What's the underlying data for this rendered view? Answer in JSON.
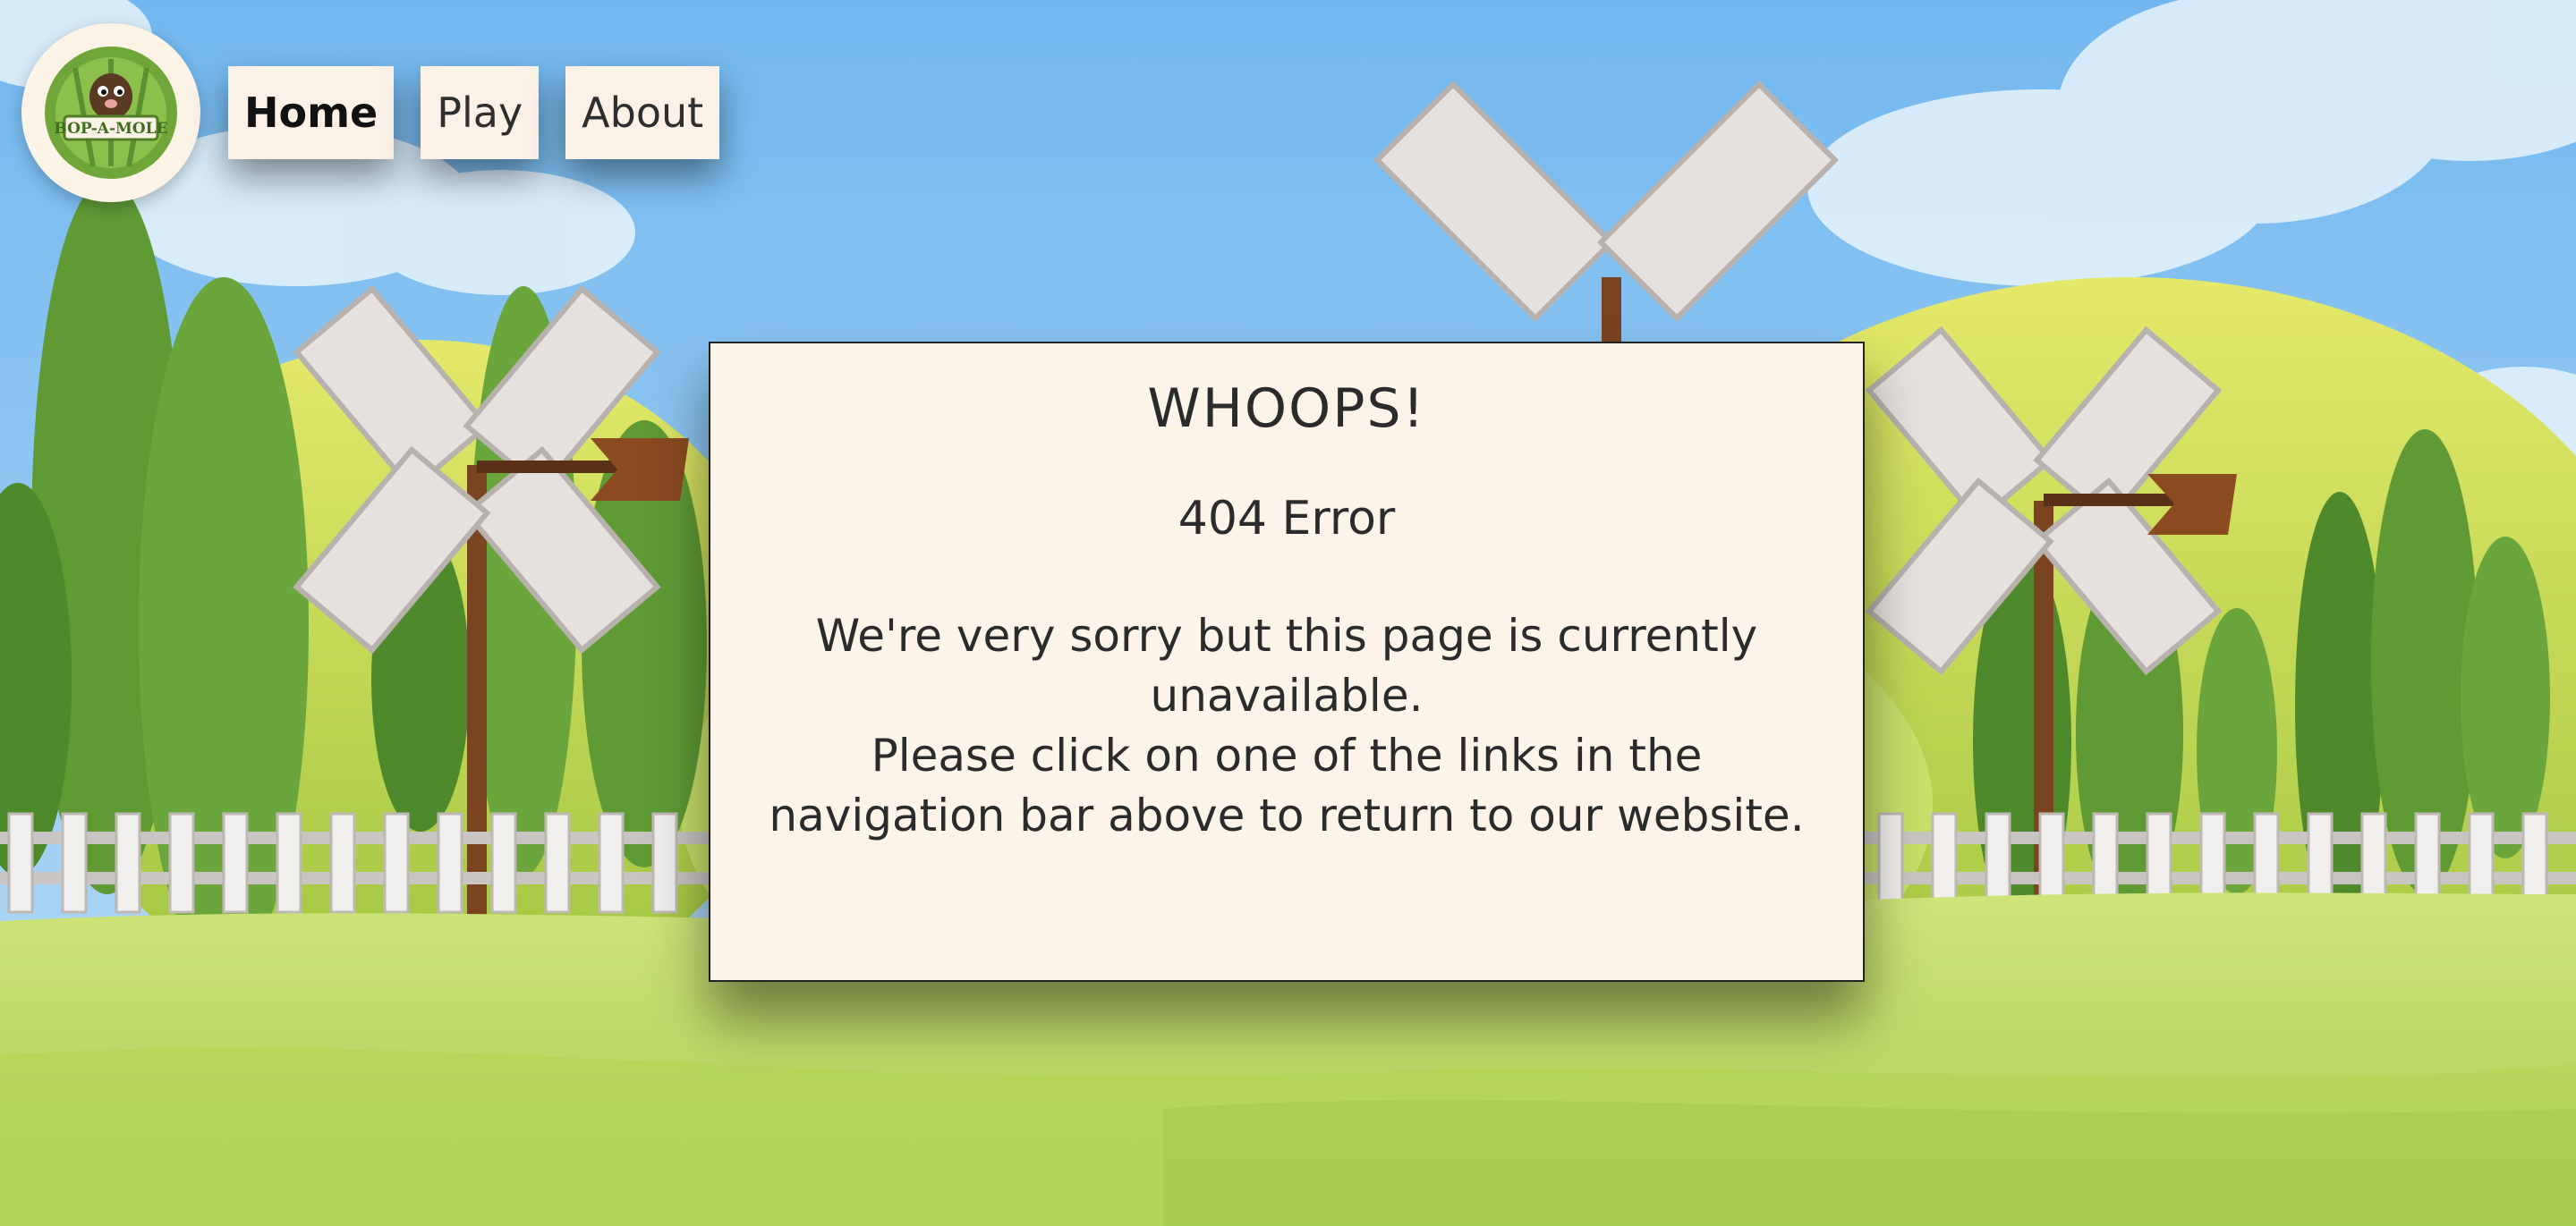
{
  "logo": {
    "text": "BOP-A-MOLE"
  },
  "nav": {
    "items": [
      {
        "label": "Home",
        "active": true
      },
      {
        "label": "Play",
        "active": false
      },
      {
        "label": "About",
        "active": false
      }
    ]
  },
  "error": {
    "title": "WHOOPS!",
    "code": "404 Error",
    "line1": "We're very sorry but this page is currently unavailable.",
    "line2": "Please click on one of the links in the navigation bar above to return to our website."
  },
  "colors": {
    "sky": "#8cc6f0",
    "grass": "#b6d85a",
    "panel_bg": "#fcf3e9",
    "nav_bg": "#fbf1e6"
  }
}
